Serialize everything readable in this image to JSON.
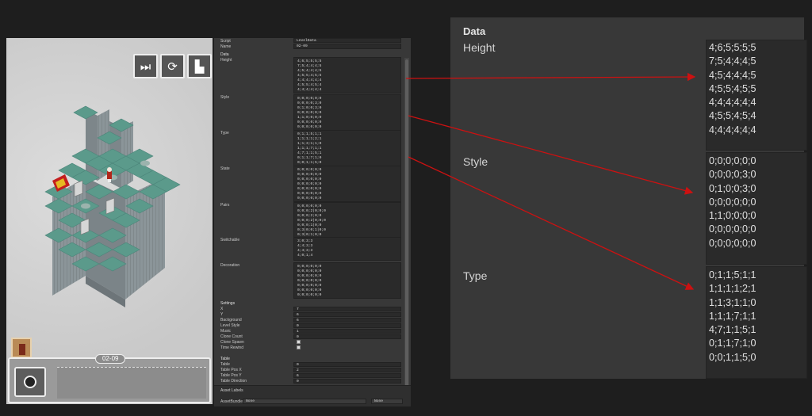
{
  "game": {
    "buttons": {
      "skip_icon": "skip-icon",
      "restart_icon": "restart-icon",
      "stats_icon": "stats-icon"
    },
    "level_label": "02-09"
  },
  "inspector": {
    "script_label": "Script",
    "script_value": "LevelData",
    "name_label": "Name",
    "name_value": "02-09",
    "data_header": "Data",
    "height_label": "Height",
    "style_label": "Style",
    "type_label": "Type",
    "state_label": "State",
    "pairs_label": "Pairs",
    "switchable_label": "Switchable",
    "decoration_label": "Decoration",
    "height_lines": "4;6;5;5;5;5\n7;5;4;4;4;5\n4;5;4;4;4;5\n4;5;5;4;5;5\n4;4;4;4;4;4\n4;5;5;4;5;4\n4;4;4;4;4;4",
    "style_lines": "0;0;0;0;0;0\n0;0;0;0;3;0\n0;1;0;0;3;0\n0;0;0;0;0;0\n1;1;0;0;0;0\n0;0;0;0;0;0\n0;0;0;0;0;0",
    "type_lines": "0;1;1;5;1;1\n1;1;1;1;2;1\n1;1;3;1;1;0\n1;1;1;7;1;1\n4;7;1;1;5;1\n0;1;1;7;1;0\n0;0;1;1;5;0",
    "state_lines": "0;0;0;0;0;0\n0;0;0;0;0;0\n0;0;0;0;0;0\n0;0;0;0;0;0\n0;0;0;0;0;0\n0;0;0;0;0;0\n0;0;0;0;0;0",
    "pairs_lines": "0;0;0;0;0;0\n0;0;0;2|0;0;0\n0;0;0;2;0;0\n0;0;0;2|0;0;0\n0;0;0;1|0;0\n0;3|0;0;1|0;0\n0;3|0;1;0;0",
    "switchable_lines": "3;0;3;3\n4;4;3;3\n4;4;3;3\n4;0;1;4",
    "decoration_lines": "0;0;0;0;0;0\n0;0;0;0;0;0\n0;0;0;0;0;0\n0;0;0;0;0;0\n0;0;0;0;0;0\n0;0;0;0;0;0\n0;0;0;0;0;0",
    "settings_header": "Settings",
    "settings": [
      {
        "label": "X",
        "value": "7"
      },
      {
        "label": "Y",
        "value": "6"
      },
      {
        "label": "Background",
        "value": "6"
      },
      {
        "label": "Level Style",
        "value": "0"
      },
      {
        "label": "Music",
        "value": "1"
      },
      {
        "label": "Clone Count",
        "value": "0"
      },
      {
        "label": "Clone Spawn",
        "value": ""
      },
      {
        "label": "Time Rewind",
        "value": ""
      }
    ],
    "table_header": "Table",
    "table": [
      {
        "label": "Table",
        "value": "0"
      },
      {
        "label": "Table Pos X",
        "value": "2"
      },
      {
        "label": "Table Pos Y",
        "value": "6"
      },
      {
        "label": "Table Direction",
        "value": "0"
      }
    ],
    "asset_labels": "Asset Labels",
    "asset_bundle_label": "AssetBundle",
    "asset_bundle_value": "None",
    "asset_bundle_variant": "None"
  },
  "zoom": {
    "data_header": "Data",
    "height_label": "Height",
    "style_label": "Style",
    "type_label": "Type",
    "height_values": [
      "4;6;5;5;5;5",
      "7;5;4;4;4;5",
      "4;5;4;4;4;5",
      "4;5;5;4;5;5",
      "4;4;4;4;4;4",
      "4;5;5;4;5;4",
      "4;4;4;4;4;4"
    ],
    "style_values": [
      "0;0;0;0;0;0",
      "0;0;0;0;3;0",
      "0;1;0;0;3;0",
      "0;0;0;0;0;0",
      "1;1;0;0;0;0",
      "0;0;0;0;0;0",
      "0;0;0;0;0;0"
    ],
    "type_values": [
      "0;1;1;5;1;1",
      "1;1;1;1;2;1",
      "1;1;3;1;1;0",
      "1;1;1;7;1;1",
      "4;7;1;1;5;1",
      "0;1;1;7;1;0",
      "0;0;1;1;5;0"
    ]
  },
  "colors": {
    "arrow": "#cc1111",
    "tile_top": "#5b9a8b",
    "tile_side": "#8a9498",
    "panel_bg": "#383838",
    "field_bg": "#2a2a2a"
  }
}
